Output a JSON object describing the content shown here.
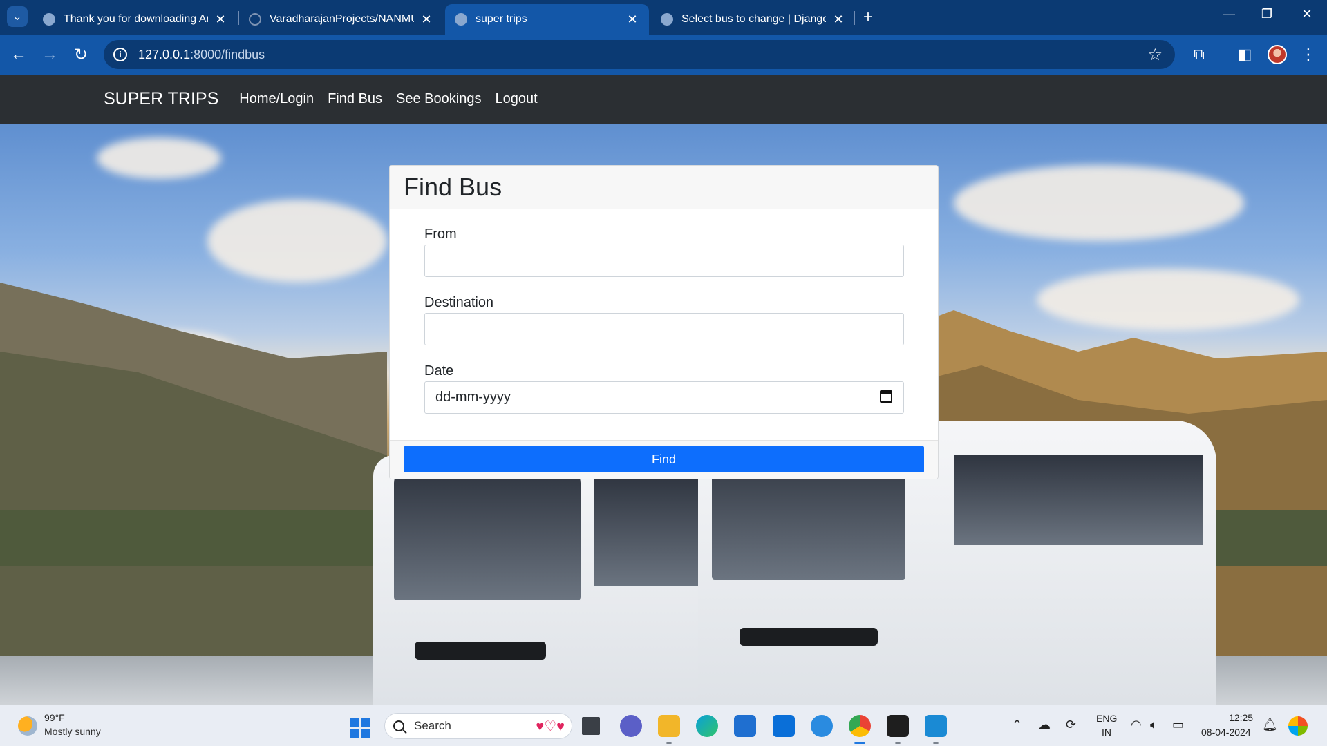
{
  "browser": {
    "tabs": [
      {
        "title": "Thank you for downloading Any",
        "active": false,
        "icon": "globe-icon"
      },
      {
        "title": "VaradharajanProjects/NANMUD",
        "active": false,
        "icon": "github-icon"
      },
      {
        "title": "super trips",
        "active": true,
        "icon": "globe-icon"
      },
      {
        "title": "Select bus to change | Django s",
        "active": false,
        "icon": "globe-icon"
      }
    ],
    "url_host": "127.0.0.1",
    "url_path": ":8000/findbus"
  },
  "site": {
    "brand": "SUPER TRIPS",
    "nav": [
      "Home/Login",
      "Find Bus",
      "See Bookings",
      "Logout"
    ]
  },
  "form": {
    "title": "Find Bus",
    "from_label": "From",
    "from_value": "",
    "destination_label": "Destination",
    "destination_value": "",
    "date_label": "Date",
    "date_placeholder": "dd-mm-yyyy",
    "submit_label": "Find",
    "accent_color": "#0d6efd"
  },
  "taskbar": {
    "weather_temp": "99°F",
    "weather_desc": "Mostly sunny",
    "search_label": "Search",
    "lang_line1": "ENG",
    "lang_line2": "IN",
    "time": "12:25",
    "date": "08-04-2024"
  }
}
